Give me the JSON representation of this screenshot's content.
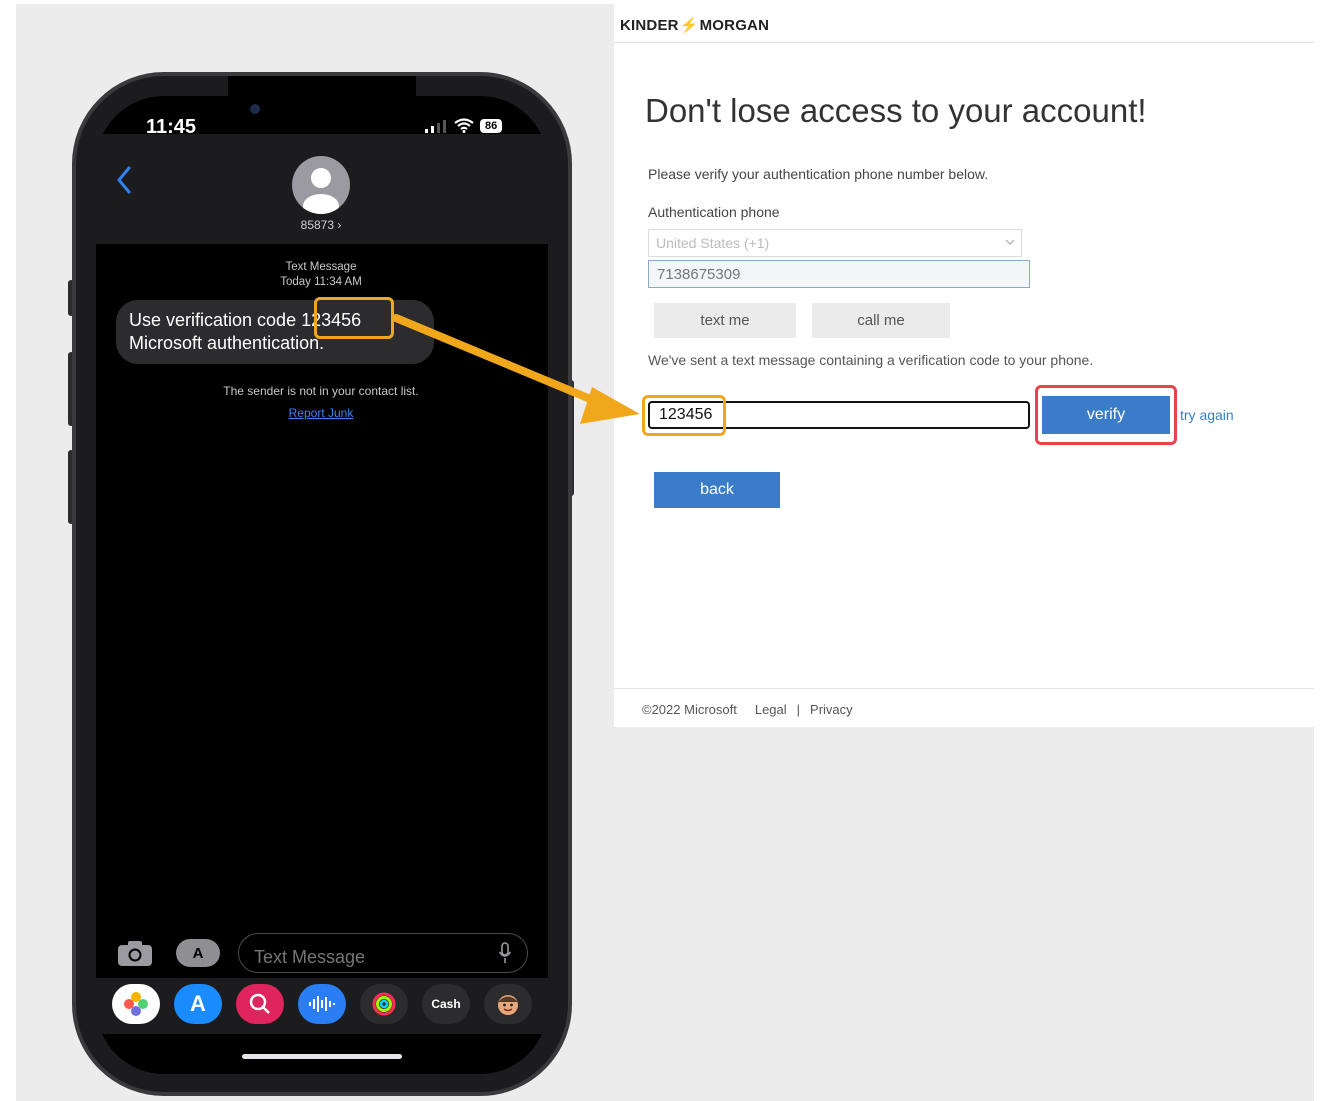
{
  "phone": {
    "time": "11:45",
    "battery": "86",
    "contact": "85873 ›",
    "message_meta_line1": "Text Message",
    "message_meta_line2": "Today 11:34 AM",
    "message_prefix": "Use verification code",
    "message_code": "123456",
    "message_line2": "Microsoft authentication.",
    "sender_note": "The sender is not in your contact list.",
    "report_junk": "Report Junk",
    "composer_placeholder": "Text Message",
    "tray_apps": [
      "photos-icon",
      "app-store-icon",
      "search-images-icon",
      "audio-message-icon",
      "fitness-icon",
      "Cash",
      "memoji-icon"
    ]
  },
  "page": {
    "logo": {
      "left": "KINDER",
      "right": "MORGAN"
    },
    "heading": "Don't lose access to your account!",
    "instruction": "Please verify your authentication phone number below.",
    "auth_phone_label": "Authentication phone",
    "country_value": "United States (+1)",
    "phone_value": "7138675309",
    "text_me": "text me",
    "call_me": "call me",
    "sent_message": "We've sent a text message containing a verification code to your phone.",
    "code_value": "123456",
    "verify": "verify",
    "try_again": "try again",
    "back": "back",
    "footer": {
      "copyright": "©2022 Microsoft",
      "legal": "Legal",
      "separator": "|",
      "privacy": "Privacy"
    }
  },
  "colors": {
    "highlight_orange": "#f0a71c",
    "highlight_red": "#e8434a",
    "button_blue": "#3b7cc8",
    "brand_red": "#c8102e"
  }
}
